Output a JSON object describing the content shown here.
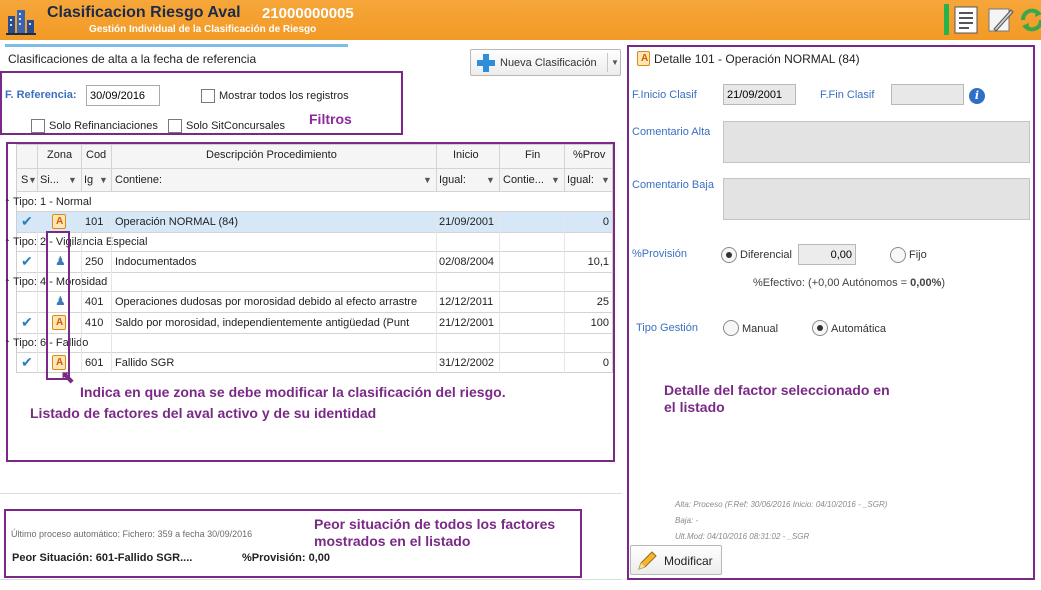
{
  "header": {
    "title": "Clasificacion Riesgo Aval",
    "code": "21000000005",
    "subtitle": "Gestión Individual de la Clasificación de Riesgo",
    "icons": [
      "building-chart-icon",
      "document-list-icon",
      "notepad-edit-icon",
      "refresh-icon"
    ]
  },
  "left": {
    "section_title": "Clasificaciones de alta a la fecha de referencia",
    "new_button_label": "Nueva Clasificación",
    "filters": {
      "fref_label": "F. Referencia:",
      "fref_value": "30/09/2016",
      "show_all_label": "Mostrar todos los registros",
      "refin_label": "Solo Refinanciaciones",
      "sitconc_label": "Solo SitConcursales",
      "annotation": "Filtros"
    },
    "grid": {
      "header_groups": [
        "Zona",
        "Cod",
        "Descripción Procedimiento",
        "Inicio",
        "Fin",
        "%Prov"
      ],
      "filter_row": [
        "S",
        "Si...",
        "Ig",
        "Contiene:",
        "Igual:",
        "Contie...",
        "Igual:"
      ],
      "groups": [
        {
          "label": "Tipo: 1 - Normal",
          "rows": [
            {
              "check": true,
              "zone": "warning",
              "cod": "101",
              "desc": "Operación NORMAL (84)",
              "inicio": "21/09/2001",
              "fin": "",
              "prov": "0"
            }
          ]
        },
        {
          "label": "Tipo: 2 - Vigilancia Especial",
          "rows": [
            {
              "check": true,
              "zone": "person",
              "cod": "250",
              "desc": "Indocumentados",
              "inicio": "02/08/2004",
              "fin": "",
              "prov": "10,1"
            }
          ]
        },
        {
          "label": "Tipo: 4 - Morosidad",
          "rows": [
            {
              "check": false,
              "zone": "person",
              "cod": "401",
              "desc": "Operaciones dudosas por morosidad debido al efecto arrastre",
              "inicio": "12/12/2011",
              "fin": "",
              "prov": "25"
            },
            {
              "check": true,
              "zone": "warning",
              "cod": "410",
              "desc": "Saldo por morosidad, independientemente antigüedad  (Punt",
              "inicio": "21/12/2001",
              "fin": "",
              "prov": "100"
            }
          ]
        },
        {
          "label": "Tipo: 6 - Fallido",
          "rows": [
            {
              "check": true,
              "zone": "warning",
              "cod": "601",
              "desc": "Fallido SGR",
              "inicio": "31/12/2002",
              "fin": "",
              "prov": "0"
            }
          ]
        }
      ],
      "annotation_zona": "Indica en que zona se debe modificar la clasificación del riesgo.",
      "annotation_listado": "Listado de factores del aval activo y de su identidad"
    },
    "footer": {
      "ultimo_proceso": "Último proceso automático: Fichero: 359 a fecha 30/09/2016",
      "peor_situacion": "Peor Situación: 601-Fallido SGR....",
      "peor_provision": "%Provisión: 0,00",
      "annotation": "Peor situación de todos los factores mostrados en el listado"
    }
  },
  "right": {
    "title": "Detalle 101 - Operación NORMAL (84)",
    "finicio_label": "F.Inicio Clasif",
    "finicio_value": "21/09/2001",
    "ffin_label": "F.Fin Clasif",
    "ffin_value": "",
    "comentario_alta_label": "Comentario Alta",
    "comentario_baja_label": "Comentario Baja",
    "provision_label": "%Provisión",
    "provision_options": [
      {
        "label": "Diferencial",
        "selected": true
      },
      {
        "label": "Fijo",
        "selected": false
      }
    ],
    "provision_value": "0,00",
    "efectivo_text": "%Efectivo: (+0,00  Autónomos = ",
    "efectivo_value": "0,00%",
    "efectivo_close": ")",
    "tipo_gestion_label": "Tipo Gestión",
    "gestion_options": [
      {
        "label": "Manual",
        "selected": false
      },
      {
        "label": "Automática",
        "selected": true
      }
    ],
    "annotation": "Detalle del factor seleccionado en el listado",
    "audit": {
      "alta": "Alta: Proceso (F.Ref: 30/06/2016 Inicio: 04/10/2016 - _SGR)",
      "baja": "Baja:   -",
      "ultmod": "Ult.Mod: 04/10/2016 08:31:02 - _SGR"
    },
    "modificar_label": "Modificar"
  },
  "colors": {
    "header": "#f29a26",
    "annotation": "#7a2a86",
    "label_blue": "#3b6fc2",
    "selected_row": "#d6e8f7"
  }
}
